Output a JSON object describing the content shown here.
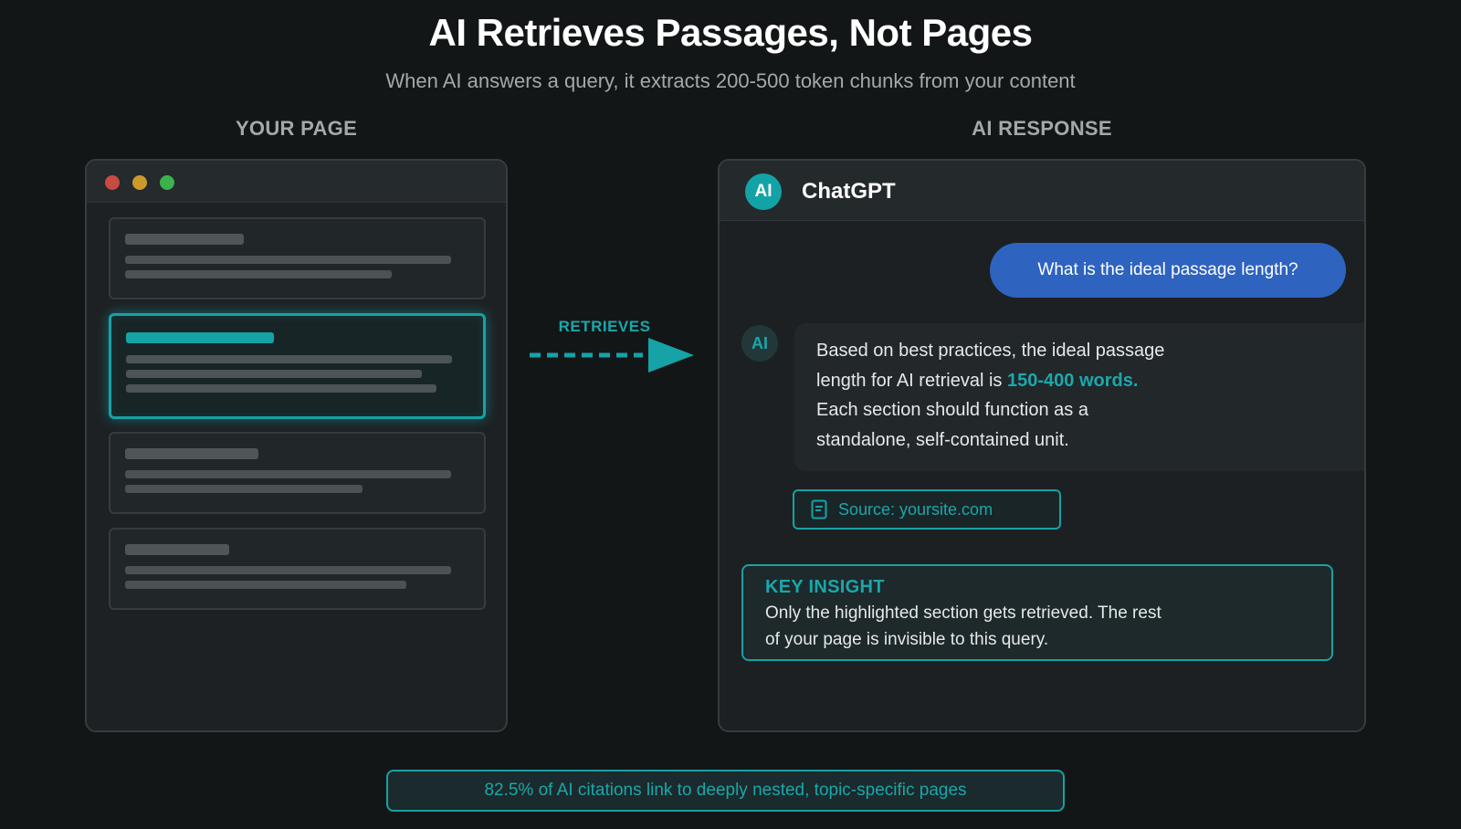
{
  "header": {
    "title": "AI Retrieves Passages, Not Pages",
    "subtitle": "When AI answers a query, it extracts 200-500 token chunks from your content"
  },
  "left_panel": {
    "label": "YOUR PAGE"
  },
  "connector": {
    "label": "RETRIEVES"
  },
  "right_panel": {
    "label": "AI RESPONSE",
    "assistant_initials": "AI",
    "assistant_name": "ChatGPT",
    "user_message": "What is the ideal passage length?",
    "answer_line1": "Based on best practices, the ideal passage",
    "answer_line2_pre": "length for AI retrieval is ",
    "answer_highlight": "150-400 words.",
    "answer_line3": "Each section should function as a",
    "answer_line4": "standalone, self-contained unit.",
    "source": "Source: yoursite.com",
    "insight_title": "KEY INSIGHT",
    "insight_line1": "Only the highlighted section gets retrieved. The rest",
    "insight_line2": "of your page is invisible to this query."
  },
  "footer": {
    "stat": "82.5% of AI citations link to deeply nested, topic-specific pages"
  },
  "colors": {
    "accent": "#16a2a6",
    "user_bubble": "#2e63c0",
    "background": "#131617"
  },
  "icons": [
    "window-close-dot",
    "window-minimize-dot",
    "window-maximize-dot",
    "dashed-arrow-icon",
    "document-icon"
  ]
}
